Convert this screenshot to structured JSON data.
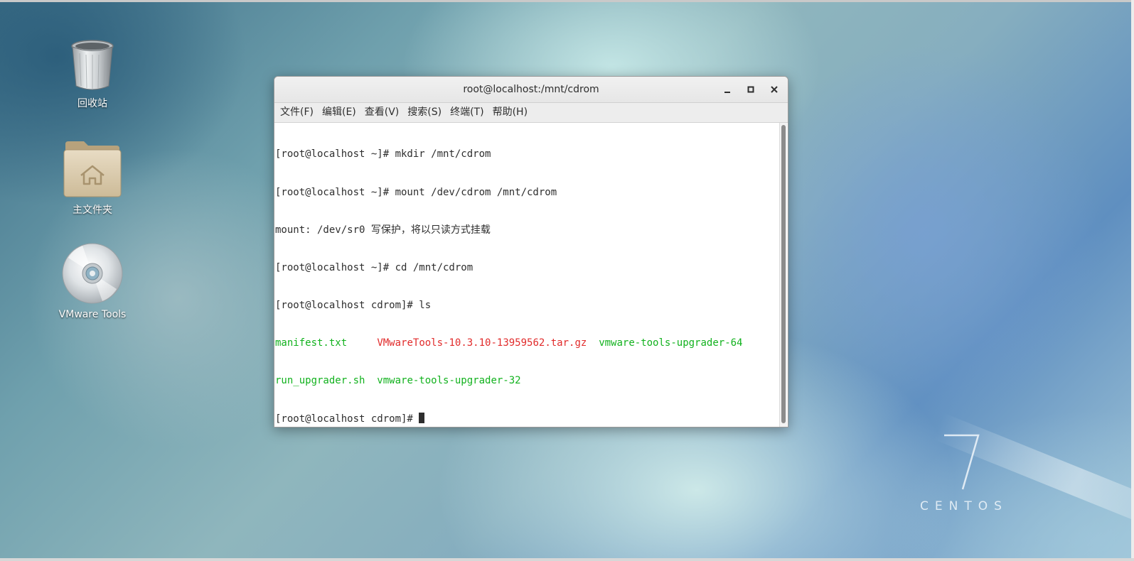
{
  "desktop": {
    "icons": [
      {
        "label": "回收站",
        "icon": "trash-icon"
      },
      {
        "label": "主文件夹",
        "icon": "home-folder-icon"
      },
      {
        "label": "VMware Tools",
        "icon": "cd-disc-icon"
      }
    ],
    "branding": {
      "digit": "7",
      "word": "CENTOS"
    }
  },
  "window": {
    "title": "root@localhost:/mnt/cdrom",
    "controls": [
      "minimize-icon",
      "maximize-icon",
      "close-icon"
    ],
    "menu": [
      "文件(F)",
      "编辑(E)",
      "查看(V)",
      "搜索(S)",
      "终端(T)",
      "帮助(H)"
    ]
  },
  "terminal": {
    "lines": [
      "[root@localhost ~]# mkdir /mnt/cdrom",
      "[root@localhost ~]# mount /dev/cdrom /mnt/cdrom",
      "mount: /dev/sr0 写保护，将以只读方式挂载",
      "[root@localhost ~]# cd /mnt/cdrom",
      "[root@localhost cdrom]# ls"
    ],
    "ls_row1": {
      "file1": "manifest.txt",
      "file2": "VMwareTools-10.3.10-13959562.tar.gz",
      "file3": "vmware-tools-upgrader-64"
    },
    "ls_row2": {
      "file1": "run_upgrader.sh",
      "file2": "vmware-tools-upgrader-32"
    },
    "prompt": "[root@localhost cdrom]# "
  },
  "colors": {
    "executable": "#12b21e",
    "archive": "#e12b2b",
    "text": "#2e2e2e"
  }
}
